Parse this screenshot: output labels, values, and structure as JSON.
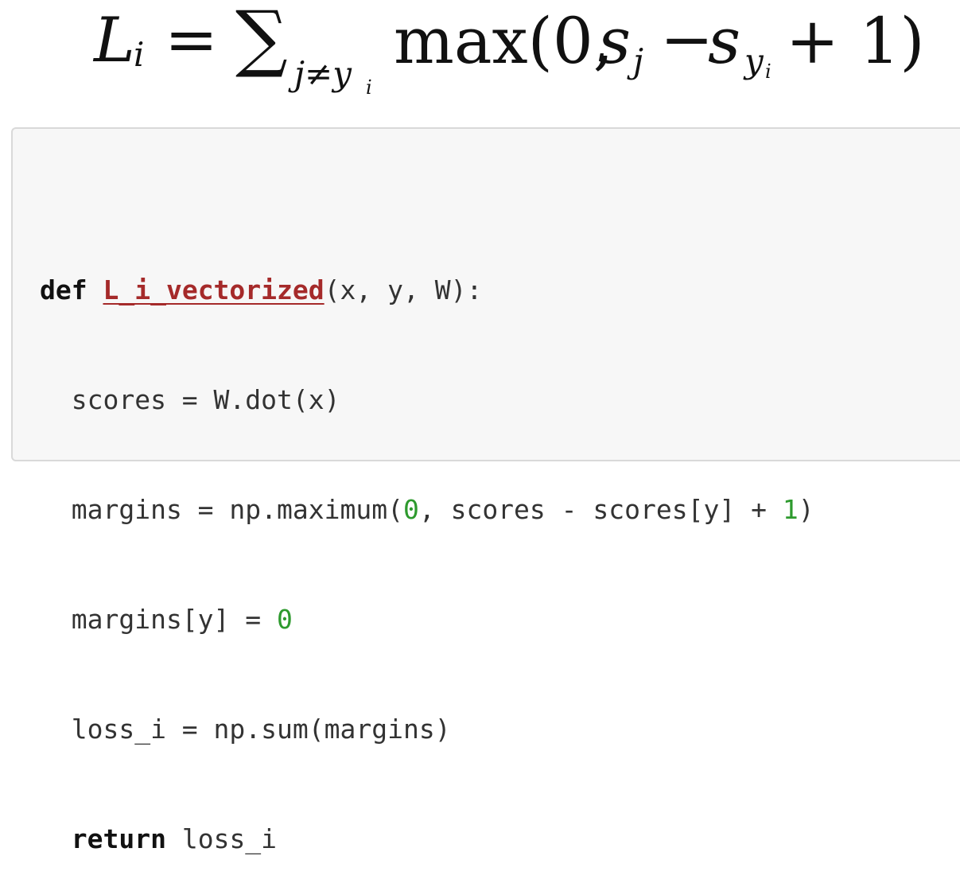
{
  "formula": {
    "lhs": "L",
    "lhs_sub": "i",
    "equals": "=",
    "sum_symbol": "∑",
    "sum_sub": "j≠y",
    "sum_sub_sub": "i",
    "func": "max(0,",
    "open_extra": "",
    "s1": "s",
    "s1_sub": "j",
    "minus": "−",
    "s2": "s",
    "s2_sub": "y",
    "s2_sub_sub": "i",
    "tail": "+ 1)"
  },
  "code": {
    "line1": {
      "kw": "def",
      "fn": "L_i_vectorized",
      "rest": "(x, y, W):"
    },
    "line2": {
      "text": "  scores = W.dot(x)"
    },
    "line3": {
      "pre": "  margins = np.maximum(",
      "n1": "0",
      "mid": ", scores - scores[y] + ",
      "n2": "1",
      "post": ")"
    },
    "line4": {
      "pre": "  margins[y] = ",
      "n1": "0"
    },
    "line5": {
      "text": "  loss_i = np.sum(margins)"
    },
    "line6": {
      "indent": "  ",
      "kw": "return",
      "rest": " loss_i"
    }
  }
}
